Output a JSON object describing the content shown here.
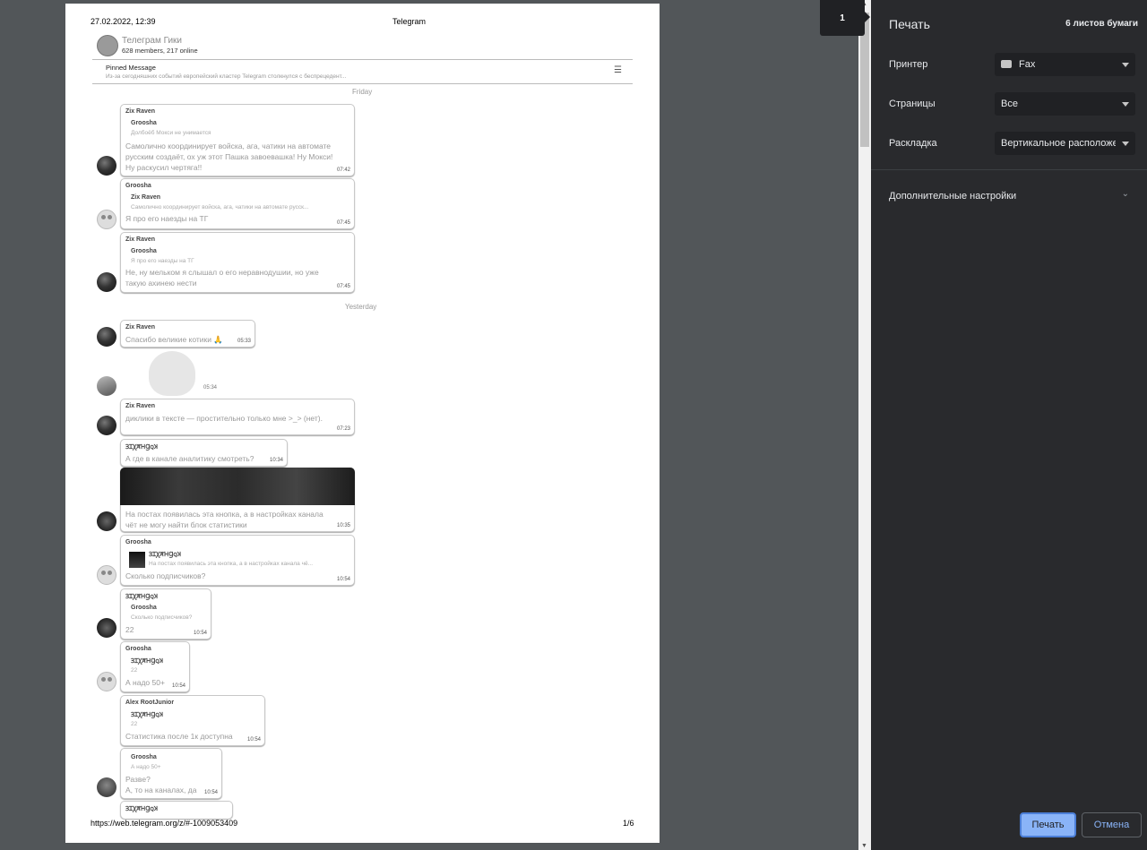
{
  "page": {
    "date": "27.02.2022, 12:39",
    "title": "Telegram",
    "url": "https://web.telegram.org/z/#-1009053409",
    "page_num": "1/6"
  },
  "channel": {
    "name": "Телеграм Гики",
    "sub": "628 members, 217 online"
  },
  "pinned": {
    "title": "Pinned Message",
    "text": "Из-за сегодняшних событий европейский кластер Telegram столкнулся с беспрецедент..."
  },
  "days": [
    "Friday",
    "Yesterday"
  ],
  "messages": [
    {
      "author": "Zix Raven",
      "reply_name": "Groosha",
      "reply_text": "Долбоёб Мокси не унимается",
      "lines": [
        "Самолично координирует войска, ага, чатики на автомате",
        "русским создаёт, ох уж этот Пашка завоевашка! Ну Мокси!",
        "Ну раскусил чертяга!!"
      ],
      "time": "07:42"
    },
    {
      "author": "Groosha",
      "reply_name": "Zix Raven",
      "reply_text": "Самолично координирует войска, ага, чатики на автомате русск...",
      "lines": [
        "Я про его наезды на ТГ"
      ],
      "time": "07:45"
    },
    {
      "author": "Zix Raven",
      "reply_name": "Groosha",
      "reply_text": "Я про его наезды на ТГ",
      "lines": [
        "Не, ну мельком я слышал о его неравнодушии, но уже",
        "такую ахинею нести"
      ],
      "time": "07:45"
    },
    {
      "author": "Zix Raven",
      "lines": [
        "Спасибо великие котики 🙏"
      ],
      "time": "05:33"
    },
    {
      "time": "05:34"
    },
    {
      "author": "Zix Raven",
      "lines": [
        "диклики в тексте — простительно только мне >_> (нет)."
      ],
      "time": "07:23"
    },
    {
      "author": "ꞫꞮꞳꞺꞪꞬꞯꞰ",
      "lines": [
        "А где в канале аналитику смотреть?"
      ],
      "time": "10:34"
    },
    {
      "lines": [
        "На постах появилась эта кнопка, а в настройках канала",
        "чёт не могу найти блок статистики"
      ],
      "time": "10:35"
    },
    {
      "author": "Groosha",
      "reply_name": "ꞫꞮꞳꞺꞪꞬꞯꞰ",
      "reply_text": "На постах появилась эта кнопка, а в настройках канала чё...",
      "lines": [
        "Сколько подписчиков?"
      ],
      "time": "10:54"
    },
    {
      "author": "ꞫꞮꞳꞺꞪꞬꞯꞰ",
      "reply_name": "Groosha",
      "reply_text": "Сколько подписчиков?",
      "lines": [
        "22"
      ],
      "time": "10:54"
    },
    {
      "author": "Groosha",
      "reply_name": "ꞫꞮꞳꞺꞪꞬꞯꞰ",
      "reply_text": "22",
      "lines": [
        "А надо 50+"
      ],
      "time": "10:54"
    },
    {
      "author": "Alex RootJunior",
      "reply_name": "ꞫꞮꞳꞺꞪꞬꞯꞰ",
      "reply_text": "22",
      "lines": [
        "Статистика после 1к доступна"
      ],
      "time": "10:54"
    },
    {
      "reply_name": "Groosha",
      "reply_text": "А надо 50+",
      "lines": [
        "Разве?",
        "А, то на каналах, да"
      ],
      "time": "10:54"
    },
    {
      "author": "ꞫꞮꞳꞺꞪꞬꞯꞰ"
    }
  ],
  "print_panel": {
    "page_badge": "1",
    "title": "Печать",
    "sheets": "6 листов бумаги",
    "printer_label": "Принтер",
    "printer_value": "Fax",
    "pages_label": "Страницы",
    "pages_value": "Все",
    "layout_label": "Раскладка",
    "layout_value": "Вертикальное расположение",
    "more_settings": "Дополнительные настройки",
    "print_button": "Печать",
    "cancel_button": "Отмена"
  }
}
